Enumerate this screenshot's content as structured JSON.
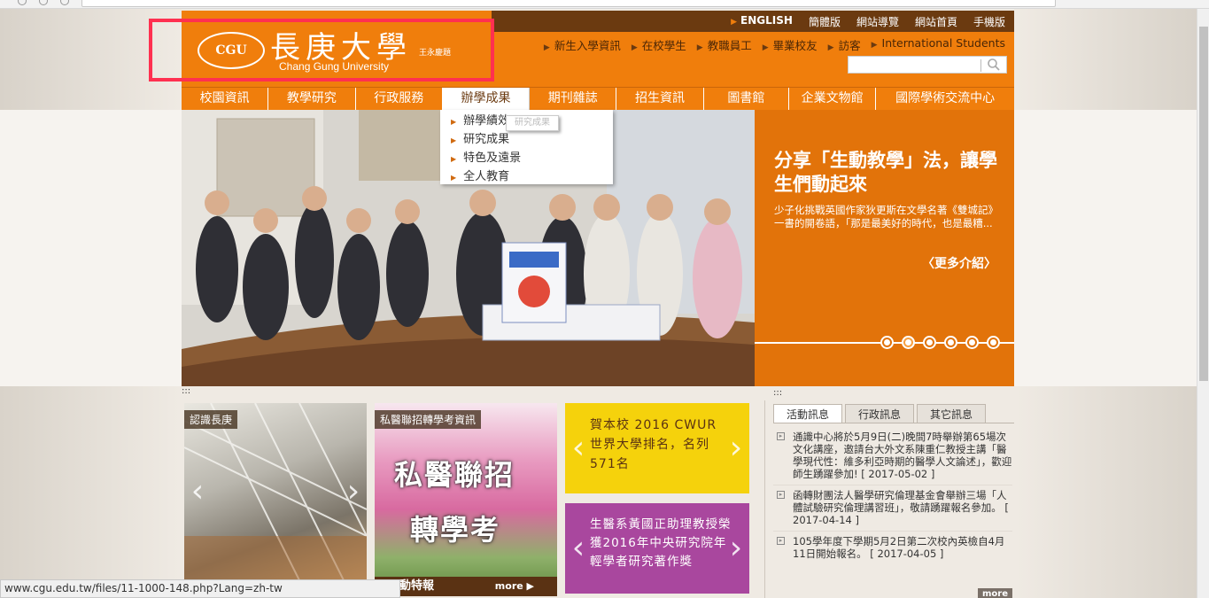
{
  "status_bar": {
    "url": "www.cgu.edu.tw/files/11-1000-148.php?Lang=zh-tw"
  },
  "logo": {
    "chinese_name": "長庚大學",
    "english_name": "Chang Gung University",
    "signature": "王永慶題",
    "emblem_text": "CGU"
  },
  "top_links": [
    {
      "label": "ENGLISH"
    },
    {
      "label": "簡體版"
    },
    {
      "label": "網站導覽"
    },
    {
      "label": "網站首頁"
    },
    {
      "label": "手機版"
    }
  ],
  "second_links": [
    {
      "label": "新生入學資訊"
    },
    {
      "label": "在校學生"
    },
    {
      "label": "教職員工"
    },
    {
      "label": "畢業校友"
    },
    {
      "label": "訪客"
    },
    {
      "label": "International Students"
    }
  ],
  "search": {
    "placeholder": ""
  },
  "nav": [
    {
      "label": "校園資訊"
    },
    {
      "label": "教學研究"
    },
    {
      "label": "行政服務"
    },
    {
      "label": "辦學成果"
    },
    {
      "label": "期刊雜誌"
    },
    {
      "label": "招生資訊"
    },
    {
      "label": "圖書館"
    },
    {
      "label": "企業文物館"
    },
    {
      "label": "國際學術交流中心"
    }
  ],
  "dropdown": {
    "items": [
      {
        "label": "辦學績效"
      },
      {
        "label": "研究成果"
      },
      {
        "label": "特色及遠景"
      },
      {
        "label": "全人教育"
      }
    ],
    "tooltip": "研究成果"
  },
  "hero": {
    "title": "分享「生動教學」法，讓學生們動起來",
    "description": "少子化挑戰英國作家狄更斯在文學名著《雙城記》一書的開卷語，「那是最美好的時代，也是最糟...",
    "more": "〈更多介紹〉",
    "slide_count": 6,
    "active_slide": 2
  },
  "tiles": {
    "tile1_label": "認識長庚",
    "tile2_label": "私醫聯招轉學考資訊",
    "tile2_big1": "私醫聯招",
    "tile2_big2": "轉學考",
    "tile2_footer": "動特報",
    "tile2_more": "more ▶",
    "tile3_text": "賀本校 2016 CWUR 世界大學排名，名列571名",
    "tile4_text": "生醫系黃國正助理教授榮獲2016年中央研究院年輕學者研究著作獎"
  },
  "dots_marker": ":::",
  "news": {
    "tabs": [
      {
        "label": "活動訊息"
      },
      {
        "label": "行政訊息"
      },
      {
        "label": "其它訊息"
      }
    ],
    "items": [
      {
        "text": "通識中心將於5月9日(二)晚間7時舉辦第65場次文化講座，邀請台大外文系陳重仁教授主講「醫學現代性：維多利亞時期的醫學人文論述」，歡迎師生踴躍參加!",
        "date": "[ 2017-05-02 ]"
      },
      {
        "text": "函轉財團法人醫學研究倫理基金會舉辦三場「人體試驗研究倫理講習班」，敬請踴躍報名參加。",
        "date": "[ 2017-04-14 ]"
      },
      {
        "text": "105學年度下學期5月2日第二次校內英檢自4月11日開始報名。",
        "date": "[ 2017-04-05 ]"
      }
    ],
    "more": "more"
  },
  "colors": {
    "brand_orange": "#f07e0c",
    "brand_brown": "#6b3a10",
    "highlight_red": "#ff3050"
  }
}
